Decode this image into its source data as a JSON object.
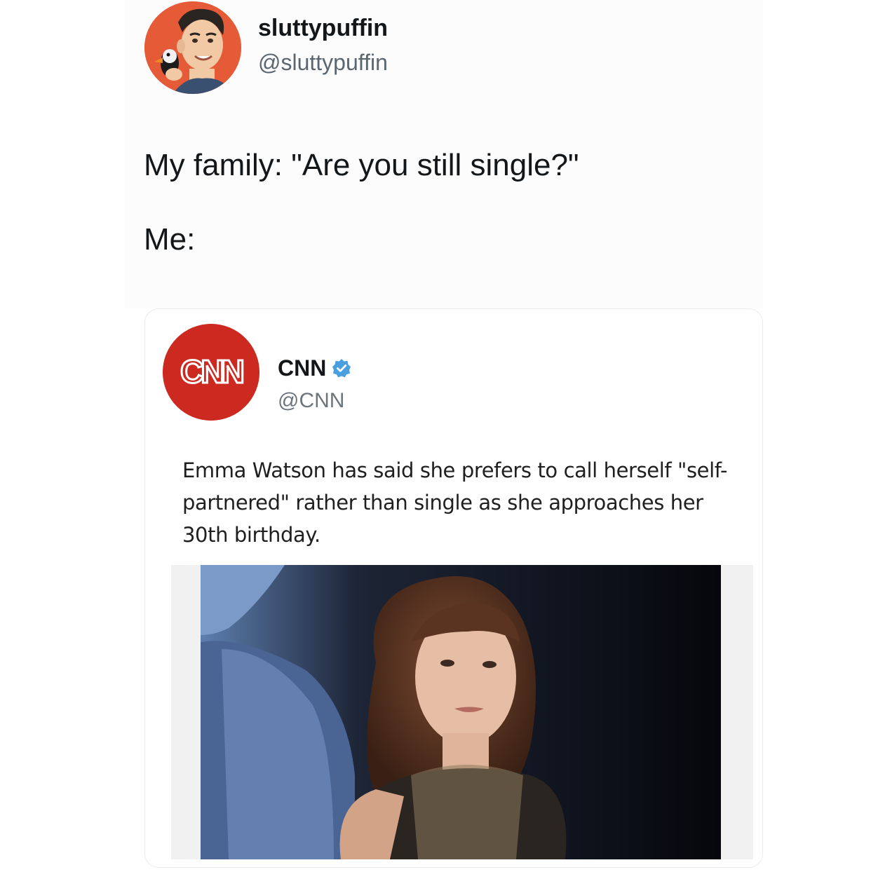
{
  "tweet": {
    "display_name": "sluttypuffin",
    "handle": "@sluttypuffin",
    "text_line1": "My family: \"Are you still single?\"",
    "text_line2": "Me:"
  },
  "quoted_tweet": {
    "logo_text": "CNN",
    "display_name": "CNN",
    "verified": true,
    "handle": "@CNN",
    "headline": "Emma Watson has said she prefers to call herself \"self-partnered\" rather than single as she approaches her 30th birthday."
  },
  "colors": {
    "avatar_bg": "#e55a37",
    "cnn_red": "#cc2a20",
    "verified_blue": "#4a9fe0",
    "text_primary": "#14171a",
    "text_secondary": "#5b6670"
  },
  "icons": {
    "avatar": "memoji-avatar-with-puffin",
    "verified": "verified-badge-icon"
  }
}
